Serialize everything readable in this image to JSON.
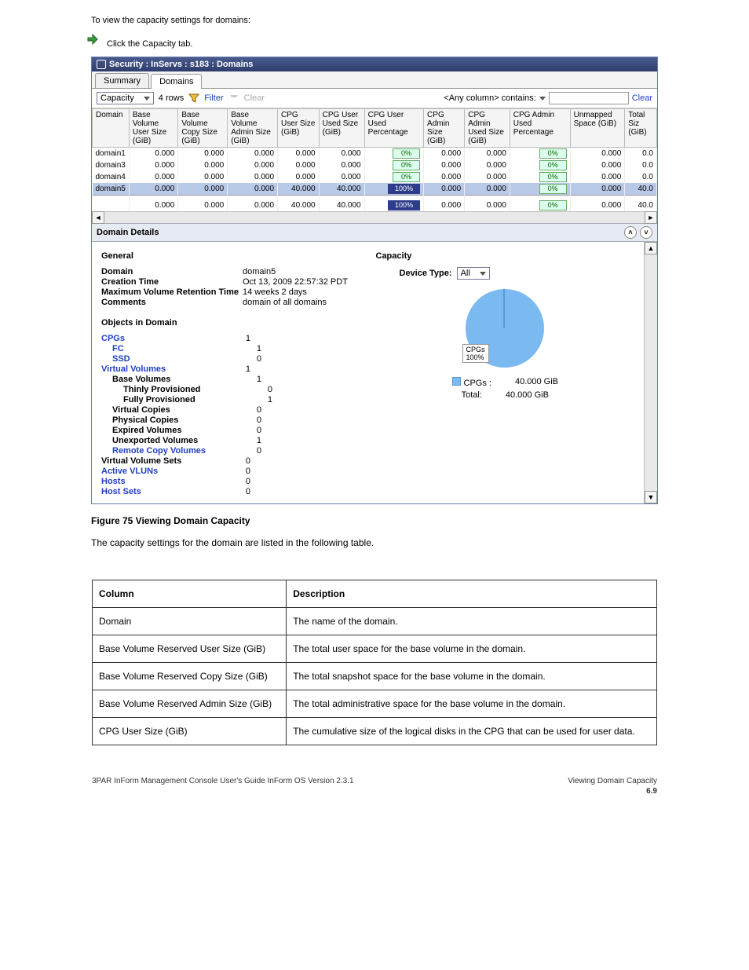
{
  "doc": {
    "pre_text": "To view the capacity settings for domains:",
    "step": "Click the Capacity tab.",
    "figure_caption": "Figure 75 Viewing Domain Capacity",
    "post_text": "The capacity settings for the domain are listed in the following table."
  },
  "window": {
    "title": "Security : InServs : s183 : Domains",
    "tabs": [
      {
        "label": "Summary",
        "active": false
      },
      {
        "label": "Domains",
        "active": true
      }
    ],
    "toolbar": {
      "view_selector": "Capacity",
      "rows": "4 rows",
      "filter": "Filter",
      "clear_filter": "Clear",
      "search_label": "<Any column> contains:",
      "clear": "Clear"
    },
    "grid": {
      "headers": [
        "Domain",
        "Base Volume User Size (GiB)",
        "Base Volume Copy Size (GiB)",
        "Base Volume Admin Size (GiB)",
        "CPG User Size (GiB)",
        "CPG User Used Size (GiB)",
        "CPG User Used Percentage",
        "CPG Admin Size (GiB)",
        "CPG Admin Used Size (GiB)",
        "CPG Admin Used Percentage",
        "Unmapped Space (GiB)",
        "Total Siz (GiB)"
      ],
      "rows": [
        {
          "c": [
            "domain1",
            "0.000",
            "0.000",
            "0.000",
            "0.000",
            "0.000",
            "0%",
            "0.000",
            "0.000",
            "0%",
            "0.000",
            "0.0"
          ],
          "full": false
        },
        {
          "c": [
            "domain3",
            "0.000",
            "0.000",
            "0.000",
            "0.000",
            "0.000",
            "0%",
            "0.000",
            "0.000",
            "0%",
            "0.000",
            "0.0"
          ],
          "full": false
        },
        {
          "c": [
            "domain4",
            "0.000",
            "0.000",
            "0.000",
            "0.000",
            "0.000",
            "0%",
            "0.000",
            "0.000",
            "0%",
            "0.000",
            "0.0"
          ],
          "full": false
        },
        {
          "c": [
            "domain5",
            "0.000",
            "0.000",
            "0.000",
            "40.000",
            "40.000",
            "100%",
            "0.000",
            "0.000",
            "0%",
            "0.000",
            "40.0"
          ],
          "full": true,
          "sel": true
        }
      ],
      "total": {
        "c": [
          "",
          "0.000",
          "0.000",
          "0.000",
          "40.000",
          "40.000",
          "100%",
          "0.000",
          "0.000",
          "0%",
          "0.000",
          "40.0"
        ],
        "full": true
      }
    },
    "details": {
      "title": "Domain Details",
      "general_h": "General",
      "kv": [
        {
          "k": "Domain",
          "v": "domain5"
        },
        {
          "k": "Creation Time",
          "v": "Oct 13, 2009 22:57:32 PDT"
        },
        {
          "k": "Maximum Volume Retention Time",
          "v": "14 weeks 2 days"
        },
        {
          "k": "Comments",
          "v": "domain of all domains"
        }
      ],
      "objects_h": "Objects in Domain",
      "objects": [
        {
          "lbl": "CPGs",
          "v": "1",
          "link": true,
          "bold": true,
          "indent": 0
        },
        {
          "lbl": "FC",
          "v": "1",
          "link": true,
          "bold": true,
          "indent": 1
        },
        {
          "lbl": "SSD",
          "v": "0",
          "link": true,
          "bold": true,
          "indent": 1
        },
        {
          "lbl": "Virtual Volumes",
          "v": "1",
          "link": true,
          "bold": true,
          "indent": 0
        },
        {
          "lbl": "Base Volumes",
          "v": "1",
          "bold": true,
          "indent": 1
        },
        {
          "lbl": "Thinly Provisioned",
          "v": "0",
          "bold": true,
          "indent": 2
        },
        {
          "lbl": "Fully Provisioned",
          "v": "1",
          "bold": true,
          "indent": 2
        },
        {
          "lbl": "Virtual Copies",
          "v": "0",
          "bold": true,
          "indent": 1
        },
        {
          "lbl": "Physical Copies",
          "v": "0",
          "bold": true,
          "indent": 1
        },
        {
          "lbl": "Expired Volumes",
          "v": "0",
          "bold": true,
          "indent": 1
        },
        {
          "lbl": "Unexported Volumes",
          "v": "1",
          "bold": true,
          "indent": 1
        },
        {
          "lbl": "Remote Copy Volumes",
          "v": "0",
          "link": true,
          "bold": true,
          "indent": 1
        },
        {
          "lbl": "Virtual Volume Sets",
          "v": "0",
          "bold": true,
          "indent": 0
        },
        {
          "lbl": "Active VLUNs",
          "v": "0",
          "link": true,
          "bold": true,
          "indent": 0
        },
        {
          "lbl": "Hosts",
          "v": "0",
          "link": true,
          "bold": true,
          "indent": 0
        },
        {
          "lbl": "Host Sets",
          "v": "0",
          "link": true,
          "bold": true,
          "indent": 0
        }
      ],
      "capacity_h": "Capacity",
      "device_type_label": "Device Type:",
      "device_type_value": "All",
      "pie_label": "CPGs\n100%",
      "cap_rows": [
        {
          "k": "CPGs :",
          "v": "40.000 GiB",
          "swatch": true
        },
        {
          "k": "Total:",
          "v": "40.000 GiB"
        }
      ]
    }
  },
  "table2": {
    "head": [
      "Column",
      "Description"
    ],
    "rows": [
      [
        "Domain",
        "The name of the domain."
      ],
      [
        "Base Volume Reserved User Size (GiB)",
        "The total user space for the base volume in the domain."
      ],
      [
        "Base Volume Reserved Copy Size (GiB)",
        "The total snapshot space for the base volume in the domain."
      ],
      [
        "Base Volume Reserved Admin Size (GiB)",
        "The total administrative space for the base volume in the domain."
      ],
      [
        "CPG User Size (GiB)",
        "The cumulative size of the logical disks in the CPG that can be used for user data."
      ]
    ]
  },
  "footer": {
    "left": "3PAR InForm Management Console User's Guide InForm OS Version 2.3.1",
    "right": "Viewing Domain Capacity",
    "page": "6.9"
  },
  "chart_data": {
    "type": "pie",
    "title": "Capacity",
    "series": [
      {
        "name": "CPGs",
        "value": 40.0,
        "pct": 100
      }
    ],
    "total": 40.0,
    "unit": "GiB"
  }
}
